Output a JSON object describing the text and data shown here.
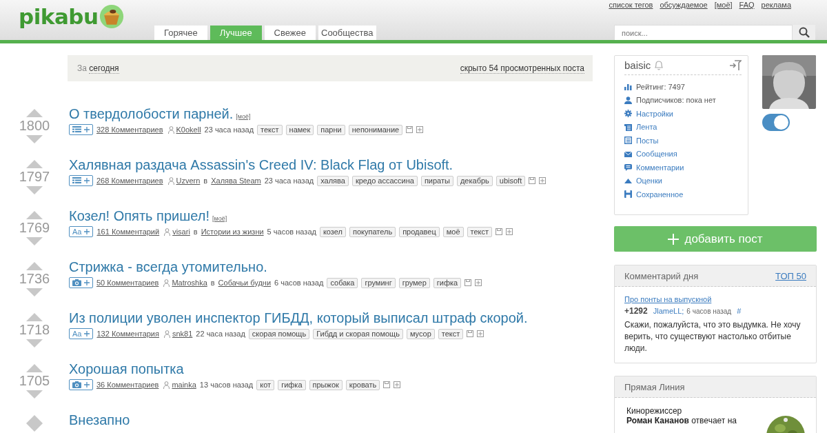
{
  "header": {
    "logo": "pikabu",
    "top_links": [
      "список тегов",
      "обсуждаемое",
      "[моё]",
      "FAQ",
      "реклама"
    ],
    "tabs": [
      {
        "label": "Горячее",
        "selected": false
      },
      {
        "label": "Лучшее",
        "selected": true
      },
      {
        "label": "Свежее",
        "selected": false
      },
      {
        "label": "Сообщества",
        "selected": false
      }
    ],
    "search": {
      "placeholder": "поиск..."
    }
  },
  "filter": {
    "prefix": "За",
    "period": "сегодня",
    "hidden": "скрыто 54 просмотренных поста"
  },
  "posts": [
    {
      "score": "1800",
      "title": "О твердолобости парней.",
      "mine": "[моё]",
      "kind": "list",
      "comments": "328 Комментариев",
      "author": "K0okell",
      "time": "23 часа назад",
      "tags": [
        "текст",
        "намек",
        "парни",
        "непонимание"
      ]
    },
    {
      "score": "1797",
      "title": "Халявная раздача Assassin's Creed IV: Black Flag от Ubisoft.",
      "kind": "list",
      "comments": "268 Комментариев",
      "author": "Uzvern",
      "preposition": "в",
      "community": "Халява Steam",
      "time": "23 часа назад",
      "tags": [
        "халява",
        "кредо ассассина",
        "пираты",
        "декабрь",
        "ubisoft"
      ]
    },
    {
      "score": "1769",
      "title": "Козел! Опять пришел!",
      "mine": "[моё]",
      "kind": "text",
      "kind_label": "Aa",
      "comments": "161 Комментарий",
      "author": "visari",
      "preposition": "в",
      "community": "Истории из жизни",
      "time": "5 часов назад",
      "tags": [
        "козел",
        "покупатель",
        "продавец",
        "моё",
        "текст"
      ]
    },
    {
      "score": "1736",
      "title": "Стрижка - всегда утомительно.",
      "comments": "50 Комментариев",
      "author": "Matroshka",
      "preposition": "в",
      "community": "Собачьи будни",
      "time": "6 часов назад",
      "tags": [
        "собака",
        "груминг",
        "грумер",
        "гифка"
      ]
    },
    {
      "score": "1718",
      "title": "Из полиции уволен инспектор ГИБДД, который выписал штраф скорой.",
      "kind": "text",
      "kind_label": "Aa",
      "comments": "132 Комментария",
      "author": "snk81",
      "time": "22 часа назад",
      "tags": [
        "скорая помощь",
        "Гибдд и скорая помощь",
        "мусор",
        "текст"
      ]
    },
    {
      "score": "1705",
      "title": "Хорошая попытка",
      "comments": "36 Комментариев",
      "author": "mainka",
      "time": "13 часов назад",
      "tags": [
        "кот",
        "гифка",
        "прыжок",
        "кровать"
      ]
    },
    {
      "title": "Внезапно"
    }
  ],
  "user_panel": {
    "username": "baisic",
    "menu": [
      {
        "kind": "rating",
        "label": "Рейтинг: 7497"
      },
      {
        "kind": "subscribers",
        "label": "Подписчиков: пока нет"
      },
      {
        "kind": "settings",
        "label": "Настройки"
      },
      {
        "kind": "feed",
        "label": "Лента"
      },
      {
        "kind": "posts",
        "label": "Посты"
      },
      {
        "kind": "messages",
        "label": "Сообщения"
      },
      {
        "kind": "comments",
        "label": "Комментарии"
      },
      {
        "kind": "ratings",
        "label": "Оценки"
      },
      {
        "kind": "saved",
        "label": "Сохраненное"
      }
    ],
    "toggle": {
      "on": true
    }
  },
  "add_post": "добавить пост",
  "comment_of_day": {
    "title": "Комментарий дня",
    "top_link": "ТОП 50",
    "post_link": "Про понты на выпускной",
    "rating": "+1292",
    "author": "JlameLL;",
    "time": "6 часов назад",
    "anchor": "#",
    "text": "Скажи, пожалуйста, что это выдумка. Не хочу верить, что существуют настолько отбитые люди."
  },
  "direct_line": {
    "title": "Прямая Линия",
    "lines": [
      "Кинорежиссер",
      "**Роман Кананов** отвечает на"
    ]
  }
}
